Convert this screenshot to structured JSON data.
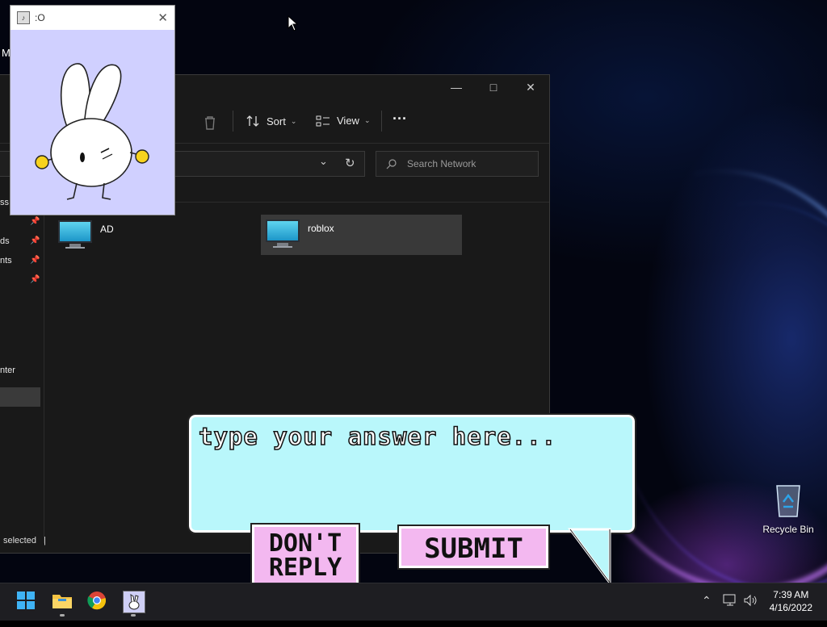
{
  "desktop": {
    "recycle_bin_label": "Recycle Bin",
    "edge_text": "M"
  },
  "explorer": {
    "toolbar": {
      "sort_label": "Sort",
      "view_label": "View",
      "more_label": "···"
    },
    "search": {
      "placeholder": "Search Network"
    },
    "sidebar": {
      "items": [
        {
          "label": "ss"
        },
        {
          "label": "ds"
        },
        {
          "label": "nts"
        },
        {
          "label": "nter"
        }
      ]
    },
    "items": [
      {
        "name": "AD"
      },
      {
        "name": "roblox"
      }
    ],
    "status_text": "selected"
  },
  "popup": {
    "title": ":O"
  },
  "dialog": {
    "prompt_text": "type your answer here...",
    "dont_reply_label": "DON'T REPLY",
    "submit_label": "SUBMIT"
  },
  "taskbar": {
    "apps": [
      {
        "icon": "windows-start-icon"
      },
      {
        "icon": "file-explorer-icon"
      },
      {
        "icon": "chrome-icon"
      },
      {
        "icon": "bunny-app-icon"
      }
    ],
    "time": "7:39 AM",
    "date": "4/16/2022"
  },
  "colors": {
    "bubble_fill": "#b9f7fb",
    "button_fill": "#f3b8f0",
    "bunny_window_bg": "#d0d0ff"
  }
}
